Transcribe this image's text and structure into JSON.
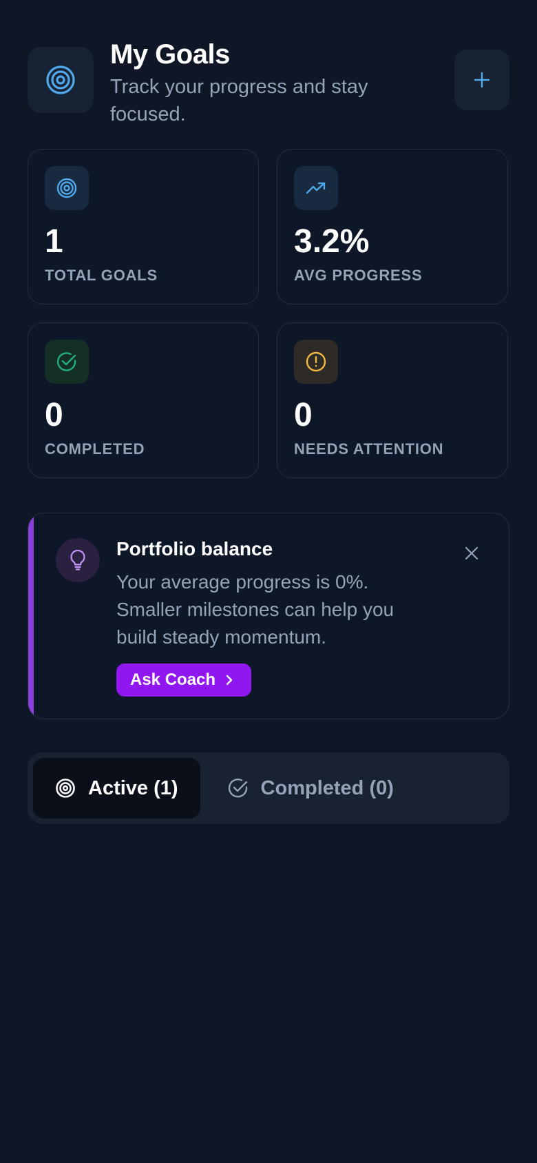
{
  "header": {
    "title": "My Goals",
    "subtitle": "Track your progress and stay focused.",
    "icon": "target-icon",
    "add_icon": "plus-icon"
  },
  "stats": [
    {
      "value": "1",
      "label": "TOTAL GOALS",
      "icon": "target-icon"
    },
    {
      "value": "3.2%",
      "label": "AVG PROGRESS",
      "icon": "trending-up-icon"
    },
    {
      "value": "0",
      "label": "COMPLETED",
      "icon": "check-circle-icon"
    },
    {
      "value": "0",
      "label": "NEEDS ATTENTION",
      "icon": "alert-circle-icon"
    }
  ],
  "insight": {
    "title": "Portfolio balance",
    "body": "Your average progress is 0%. Smaller milestones can help you build steady momentum.",
    "button_label": "Ask Coach",
    "icon": "lightbulb-icon"
  },
  "tabs": [
    {
      "label": "Active (1)",
      "icon": "target-icon",
      "active": true
    },
    {
      "label": "Completed (0)",
      "icon": "check-circle-icon",
      "active": false
    }
  ],
  "colors": {
    "background": "#0f1726",
    "accent_blue": "#4fa9ec",
    "accent_green": "#22b07d",
    "accent_amber": "#f5b841",
    "accent_purple": "#9117f0"
  }
}
